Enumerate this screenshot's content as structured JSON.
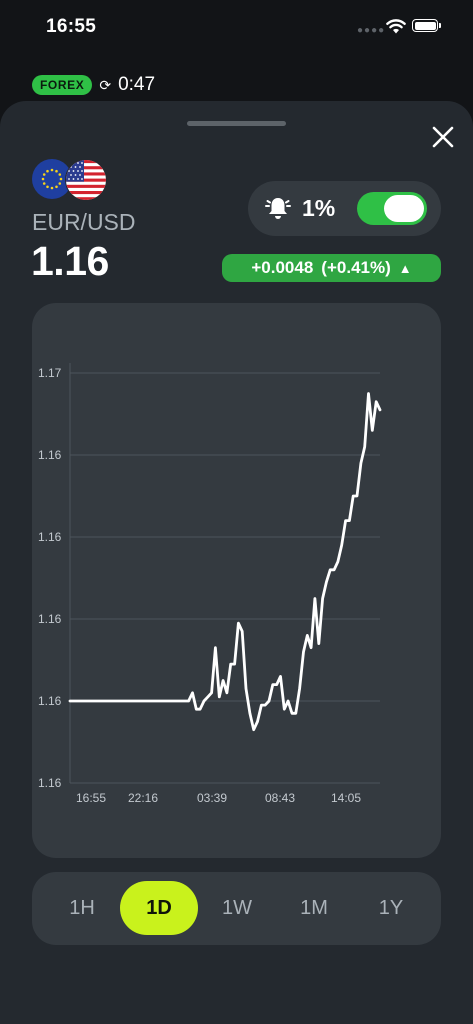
{
  "status_bar": {
    "time": "16:55"
  },
  "top_strip": {
    "badge": "FOREX",
    "countdown": "0:47"
  },
  "instrument": {
    "pair": "EUR/USD",
    "price": "1.16",
    "change_abs": "+0.0048",
    "change_pct": "(+0.41%)",
    "direction": "up"
  },
  "alert": {
    "threshold": "1%",
    "enabled": true
  },
  "colors": {
    "positive": "#2fc046",
    "accent_active": "#c9f21c",
    "line": "#ffffff"
  },
  "icons": {
    "close": "close-icon",
    "bell": "bell-icon",
    "refresh": "refresh-icon",
    "direction": "arrow-up-icon"
  },
  "timeframes": {
    "selected": "1D",
    "items": [
      "1H",
      "1D",
      "1W",
      "1M",
      "1Y"
    ]
  },
  "chart_data": {
    "type": "line",
    "grid": "horizontal",
    "y_tick_labels": [
      "1.17",
      "1.16",
      "1.16",
      "1.16",
      "1.16",
      "1.16"
    ],
    "x_tick_labels": [
      "16:55",
      "22:16",
      "03:39",
      "08:43",
      "14:05"
    ],
    "ylim": [
      1.156,
      1.166
    ],
    "series": [
      {
        "values": [
          1.158,
          1.158,
          1.158,
          1.158,
          1.158,
          1.158,
          1.158,
          1.158,
          1.158,
          1.158,
          1.158,
          1.158,
          1.158,
          1.158,
          1.158,
          1.158,
          1.158,
          1.158,
          1.158,
          1.158,
          1.158,
          1.158,
          1.158,
          1.158,
          1.158,
          1.158,
          1.158,
          1.158,
          1.158,
          1.158,
          1.158,
          1.158,
          1.1582,
          1.1578,
          1.1578,
          1.158,
          1.1581,
          1.1582,
          1.1593,
          1.1581,
          1.1585,
          1.1582,
          1.1589,
          1.1589,
          1.1599,
          1.1597,
          1.1583,
          1.1577,
          1.1573,
          1.1575,
          1.1579,
          1.1579,
          1.158,
          1.1584,
          1.1584,
          1.1586,
          1.1578,
          1.158,
          1.1577,
          1.1577,
          1.1583,
          1.1592,
          1.1596,
          1.1593,
          1.1605,
          1.1594,
          1.1605,
          1.1609,
          1.1612,
          1.1612,
          1.1614,
          1.1618,
          1.1624,
          1.1624,
          1.163,
          1.163,
          1.1638,
          1.1642,
          1.1655,
          1.1646,
          1.1653,
          1.1651
        ]
      }
    ]
  }
}
